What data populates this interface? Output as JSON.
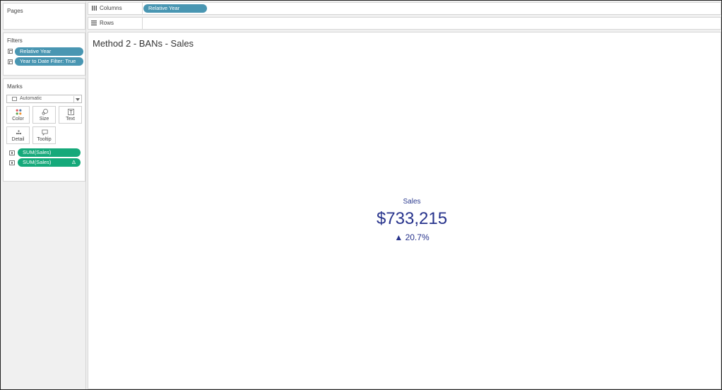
{
  "sidebar": {
    "pages": {
      "title": "Pages"
    },
    "filters": {
      "title": "Filters",
      "items": [
        {
          "label": "Relative Year"
        },
        {
          "label": "Year to Date Filter: True"
        }
      ]
    },
    "marks": {
      "title": "Marks",
      "mark_type": "Automatic",
      "buttons": [
        {
          "label": "Color",
          "icon": "color-icon"
        },
        {
          "label": "Size",
          "icon": "size-icon"
        },
        {
          "label": "Text",
          "icon": "text-icon"
        },
        {
          "label": "Detail",
          "icon": "detail-icon"
        },
        {
          "label": "Tooltip",
          "icon": "tooltip-icon"
        }
      ],
      "fields": [
        {
          "label": "SUM(Sales)",
          "delta": ""
        },
        {
          "label": "SUM(Sales)",
          "delta": "Δ"
        }
      ]
    }
  },
  "shelves": {
    "columns": {
      "label": "Columns",
      "pill": "Relative Year"
    },
    "rows": {
      "label": "Rows"
    }
  },
  "view": {
    "title": "Method 2 - BANs - Sales",
    "ban": {
      "label": "Sales",
      "value": "$733,215",
      "change": "▲ 20.7%"
    }
  },
  "colors": {
    "dimension_pill": "#4996b2",
    "measure_pill": "#15a97a",
    "ban_text": "#27338c"
  }
}
